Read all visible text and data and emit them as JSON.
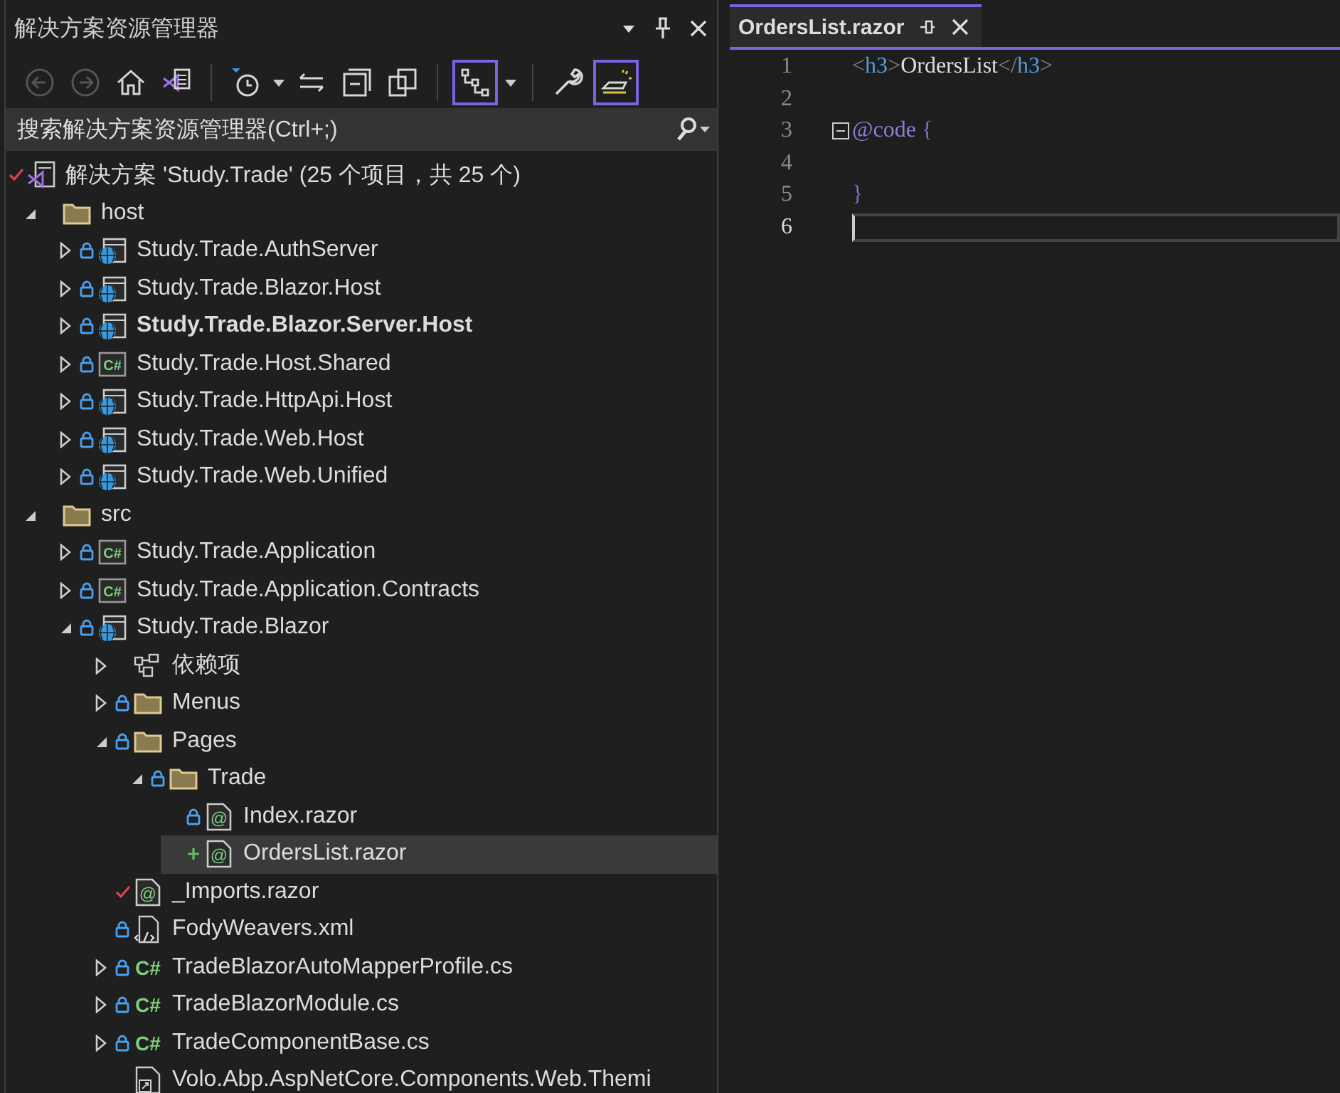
{
  "explorer": {
    "title": "解决方案资源管理器",
    "title_buttons": [
      {
        "kind": "dropdown"
      },
      {
        "kind": "pin"
      },
      {
        "kind": "close"
      }
    ],
    "toolbar": [
      {
        "kind": "back",
        "disabled": true,
        "selected": false
      },
      {
        "kind": "forward",
        "disabled": true,
        "selected": false
      },
      {
        "kind": "home",
        "disabled": false,
        "selected": false
      },
      {
        "kind": "vs-solution",
        "disabled": false,
        "selected": false
      },
      {
        "kind": "separator"
      },
      {
        "kind": "history",
        "disabled": false,
        "selected": false
      },
      {
        "kind": "caret"
      },
      {
        "kind": "sync",
        "disabled": false,
        "selected": false
      },
      {
        "kind": "collapse",
        "disabled": false,
        "selected": false
      },
      {
        "kind": "copy",
        "disabled": false,
        "selected": false
      },
      {
        "kind": "separator"
      },
      {
        "kind": "hierarchy",
        "disabled": false,
        "selected": true
      },
      {
        "kind": "caret"
      },
      {
        "kind": "separator"
      },
      {
        "kind": "wrench",
        "disabled": false,
        "selected": false
      },
      {
        "kind": "preview",
        "disabled": false,
        "selected": true
      }
    ],
    "search": {
      "placeholder": "搜索解决方案资源管理器(Ctrl+;)"
    },
    "tree": [
      {
        "label": "解决方案 'Study.Trade' (25 个项目，共 25 个)",
        "kind": "solution",
        "locked": false,
        "checked_out": true,
        "added": false,
        "selected": false,
        "children": [
          {
            "label": "host",
            "kind": "folder",
            "locked": false,
            "checked_out": false,
            "added": false,
            "expanded": true,
            "selected": false,
            "children": [
              {
                "label": "Study.Trade.AuthServer",
                "kind": "web-project",
                "locked": true,
                "checked_out": false,
                "added": false,
                "expanded": false,
                "selected": false
              },
              {
                "label": "Study.Trade.Blazor.Host",
                "kind": "web-project",
                "locked": true,
                "checked_out": false,
                "added": false,
                "expanded": false,
                "selected": false
              },
              {
                "label": "Study.Trade.Blazor.Server.Host",
                "kind": "web-project",
                "locked": true,
                "checked_out": false,
                "added": false,
                "expanded": false,
                "startup": true,
                "selected": false
              },
              {
                "label": "Study.Trade.Host.Shared",
                "kind": "csharp-project",
                "icon_text": "C#",
                "locked": true,
                "checked_out": false,
                "added": false,
                "expanded": false,
                "selected": false
              },
              {
                "label": "Study.Trade.HttpApi.Host",
                "kind": "web-project",
                "locked": true,
                "checked_out": false,
                "added": false,
                "expanded": false,
                "selected": false
              },
              {
                "label": "Study.Trade.Web.Host",
                "kind": "web-project",
                "locked": true,
                "checked_out": false,
                "added": false,
                "expanded": false,
                "selected": false
              },
              {
                "label": "Study.Trade.Web.Unified",
                "kind": "web-project",
                "locked": true,
                "checked_out": false,
                "added": false,
                "expanded": false,
                "selected": false
              }
            ]
          },
          {
            "label": "src",
            "kind": "folder",
            "locked": false,
            "checked_out": false,
            "added": false,
            "expanded": true,
            "selected": false,
            "children": [
              {
                "label": "Study.Trade.Application",
                "kind": "csharp-project",
                "icon_text": "C#",
                "locked": true,
                "checked_out": false,
                "added": false,
                "expanded": false,
                "selected": false
              },
              {
                "label": "Study.Trade.Application.Contracts",
                "kind": "csharp-project",
                "icon_text": "C#",
                "locked": true,
                "checked_out": false,
                "added": false,
                "expanded": false,
                "selected": false
              },
              {
                "label": "Study.Trade.Blazor",
                "kind": "web-project",
                "locked": true,
                "checked_out": false,
                "added": false,
                "expanded": true,
                "selected": false,
                "children": [
                  {
                    "label": "依赖项",
                    "kind": "dependencies",
                    "locked": false,
                    "checked_out": false,
                    "added": false,
                    "expanded": false,
                    "selected": false
                  },
                  {
                    "label": "Menus",
                    "kind": "folder",
                    "locked": true,
                    "checked_out": false,
                    "added": false,
                    "expanded": false,
                    "selected": false
                  },
                  {
                    "label": "Pages",
                    "kind": "folder",
                    "locked": true,
                    "checked_out": false,
                    "added": false,
                    "expanded": true,
                    "selected": false,
                    "children": [
                      {
                        "label": "Trade",
                        "kind": "folder",
                        "locked": true,
                        "checked_out": false,
                        "added": false,
                        "expanded": true,
                        "selected": false,
                        "children": [
                          {
                            "label": "Index.razor",
                            "kind": "razor",
                            "icon_text": "@",
                            "locked": true,
                            "checked_out": false,
                            "added": false,
                            "selected": false
                          },
                          {
                            "label": "OrdersList.razor",
                            "kind": "razor",
                            "icon_text": "@",
                            "locked": false,
                            "checked_out": false,
                            "added": true,
                            "selected": true
                          }
                        ]
                      }
                    ]
                  },
                  {
                    "label": "_Imports.razor",
                    "kind": "razor",
                    "icon_text": "@",
                    "locked": false,
                    "checked_out": true,
                    "added": false,
                    "selected": false
                  },
                  {
                    "label": "FodyWeavers.xml",
                    "kind": "xml",
                    "locked": true,
                    "checked_out": false,
                    "added": false,
                    "selected": false
                  },
                  {
                    "label": "TradeBlazorAutoMapperProfile.cs",
                    "kind": "cs",
                    "icon_text": "C#",
                    "locked": true,
                    "checked_out": false,
                    "added": false,
                    "expanded": false,
                    "selected": false
                  },
                  {
                    "label": "TradeBlazorModule.cs",
                    "kind": "cs",
                    "icon_text": "C#",
                    "locked": true,
                    "checked_out": false,
                    "added": false,
                    "expanded": false,
                    "selected": false
                  },
                  {
                    "label": "TradeComponentBase.cs",
                    "kind": "cs",
                    "icon_text": "C#",
                    "locked": true,
                    "checked_out": false,
                    "added": false,
                    "expanded": false,
                    "selected": false
                  },
                  {
                    "label": "Volo.Abp.AspNetCore.Components.Web.Themi",
                    "kind": "link",
                    "locked": false,
                    "checked_out": false,
                    "added": false,
                    "selected": false
                  }
                ]
              }
            ]
          }
        ]
      }
    ]
  },
  "editor": {
    "tabs": [
      {
        "title": "OrdersList.razor",
        "selected": true
      }
    ],
    "lines": [
      {
        "number": "1",
        "current": false,
        "fold": false,
        "tokens": [
          {
            "text": "<",
            "kind": "delim"
          },
          {
            "text": "h3",
            "kind": "tag"
          },
          {
            "text": ">",
            "kind": "delim"
          },
          {
            "text": "OrdersList",
            "kind": "text"
          },
          {
            "text": "</",
            "kind": "delim"
          },
          {
            "text": "h3",
            "kind": "tag"
          },
          {
            "text": ">",
            "kind": "delim"
          }
        ]
      },
      {
        "number": "2",
        "current": false,
        "fold": false
      },
      {
        "number": "3",
        "current": false,
        "fold": true,
        "tokens": [
          {
            "text": "@code",
            "kind": "keyword"
          },
          {
            "text": " {",
            "kind": "brace"
          }
        ]
      },
      {
        "number": "4",
        "current": false,
        "fold": false
      },
      {
        "number": "5",
        "current": false,
        "fold": false,
        "tokens": [
          {
            "text": "}",
            "kind": "brace"
          }
        ]
      },
      {
        "number": "6",
        "current": true,
        "fold": false
      }
    ]
  }
}
